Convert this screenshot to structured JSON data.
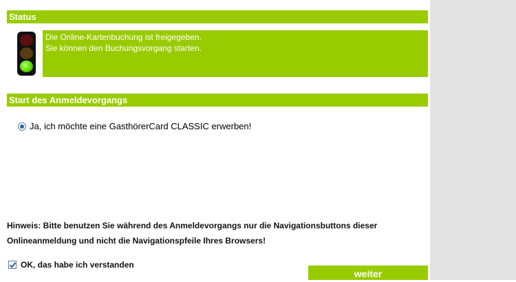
{
  "status": {
    "header": "Status",
    "light": "green",
    "lines": [
      "Die Online-Kartenbuchung ist freigegeben.",
      "Sie können den Buchungsvorgang starten."
    ]
  },
  "start": {
    "header": "Start des Anmeldevorgangs",
    "option_label": "Ja, ich möchte eine GasthörerCard CLASSIC erwerben!",
    "option_selected": true
  },
  "hint": {
    "line1": "Hinweis: Bitte benutzen Sie während des Anmeldevorgangs nur die Navigationsbuttons dieser",
    "line2": "Onlineanmeldung und nicht die Navigationspfeile Ihres Browsers!"
  },
  "confirm": {
    "label": "OK, das habe ich verstanden",
    "checked": true
  },
  "next_button": "weiter",
  "colors": {
    "accent": "#99cc00",
    "sidebar": "#e3e3e3"
  }
}
